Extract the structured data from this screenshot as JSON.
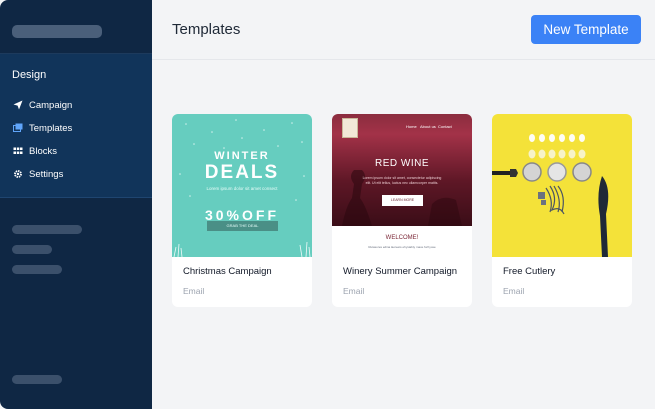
{
  "sidebar": {
    "section_heading": "Design",
    "nav": [
      {
        "label": "Campaign",
        "icon": "paper-plane-icon"
      },
      {
        "label": "Templates",
        "icon": "templates-icon"
      },
      {
        "label": "Blocks",
        "icon": "grid-icon"
      },
      {
        "label": "Settings",
        "icon": "gear-icon"
      }
    ]
  },
  "header": {
    "title": "Templates",
    "new_button_label": "New Template"
  },
  "templates": [
    {
      "name": "Christmas Campaign",
      "type": "Email",
      "thumbnail": {
        "headline_1": "WINTER",
        "headline_2": "DEALS",
        "subline": "Lorem ipsum dolor sit amet consect",
        "offer": "30%OFF",
        "cta": "GRAB THE DEAL"
      }
    },
    {
      "name": "Winery Summer Campaign",
      "type": "Email",
      "thumbnail": {
        "nav": [
          "Home",
          "About us",
          "Contact"
        ],
        "headline": "RED WINE",
        "description": "Lorem ipsum dolor sit amet, consectetur adipiscing elit. Ut elit tellus, luctus nec ullamcorper mattis.",
        "cta": "LEARN MORE",
        "welcome": "WELCOME!",
        "welcome_sub": "Rutasores edina laoreets ehysiabty maxe forhyose"
      }
    },
    {
      "name": "Free Cutlery",
      "type": "Email",
      "thumbnail": {}
    }
  ],
  "colors": {
    "sidebar_bg": "#0f2744",
    "sidebar_section_bg": "#11345a",
    "accent": "#3b82f6",
    "page_bg": "#f3f4f6"
  }
}
